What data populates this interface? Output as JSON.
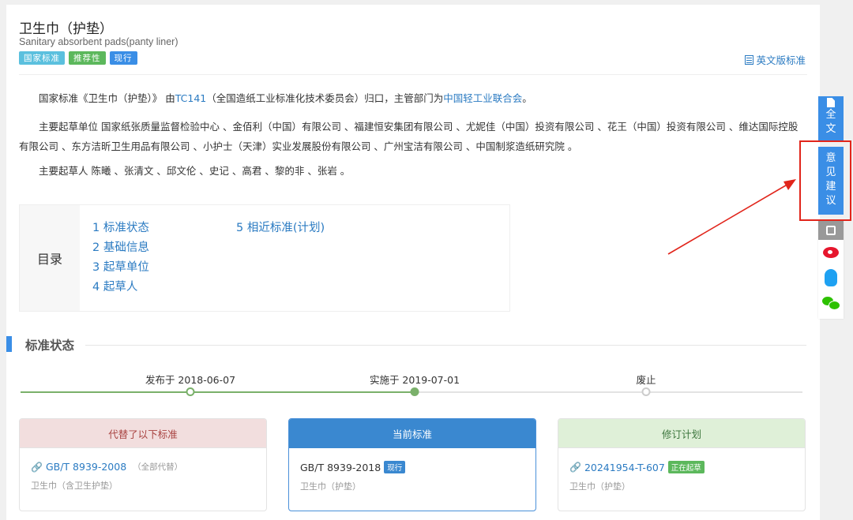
{
  "header": {
    "title": "卫生巾（护垫）",
    "subtitle": "Sanitary absorbent pads(panty liner)",
    "badges": [
      "国家标准",
      "推荐性",
      "现行"
    ],
    "english_link": "英文版标准"
  },
  "intro": {
    "p1_prefix": "国家标准《卫生巾（护垫）》 由",
    "p1_tc": "TC141",
    "p1_mid": "（全国造纸工业标准化技术委员会）归口，主管部门为",
    "p1_dept": "中国轻工业联合会",
    "p1_end": "。",
    "p2": "主要起草单位 国家纸张质量监督检验中心 、金佰利（中国）有限公司 、福建恒安集团有限公司 、尤妮佳（中国）投资有限公司 、花王（中国）投资有限公司 、维达国际控股有限公司 、东方洁昕卫生用品有限公司 、小护士（天津）实业发展股份有限公司 、广州宝洁有限公司 、中国制浆造纸研究院 。",
    "p3": "主要起草人 陈曦 、张清文 、邱文伦 、史记 、高君 、黎的非 、张岩 。"
  },
  "toc": {
    "label": "目录",
    "items": [
      "1  标准状态",
      "2  基础信息",
      "3  起草单位",
      "4  起草人",
      "5  相近标准(计划)"
    ]
  },
  "status_section": {
    "title": "标准状态",
    "timeline": [
      {
        "label": "发布于 2018-06-07",
        "state": "done"
      },
      {
        "label": "实施于 2019-07-01",
        "state": "current"
      },
      {
        "label": "废止",
        "state": "pending"
      }
    ],
    "progress": 0.505
  },
  "cards": [
    {
      "head": "代替了以下标准",
      "code": "GB/T 8939-2008",
      "note": "（全部代替）",
      "desc": "卫生巾（含卫生护垫）",
      "icon": "link-icon"
    },
    {
      "head": "当前标准",
      "code": "GB/T 8939-2018",
      "tag": "现行",
      "desc": "卫生巾（护垫）"
    },
    {
      "head": "修订计划",
      "code": "20241954-T-607",
      "tag": "正在起草",
      "desc": "卫生巾（护垫）",
      "icon": "link-icon"
    }
  ],
  "sidebar": {
    "full_text": "全文",
    "opinion": "意见建议"
  },
  "colors": {
    "accent": "#3a8ee6",
    "link": "#2b7bc2",
    "highlight": "#e1251b",
    "timeline_done": "#7ab06a"
  }
}
